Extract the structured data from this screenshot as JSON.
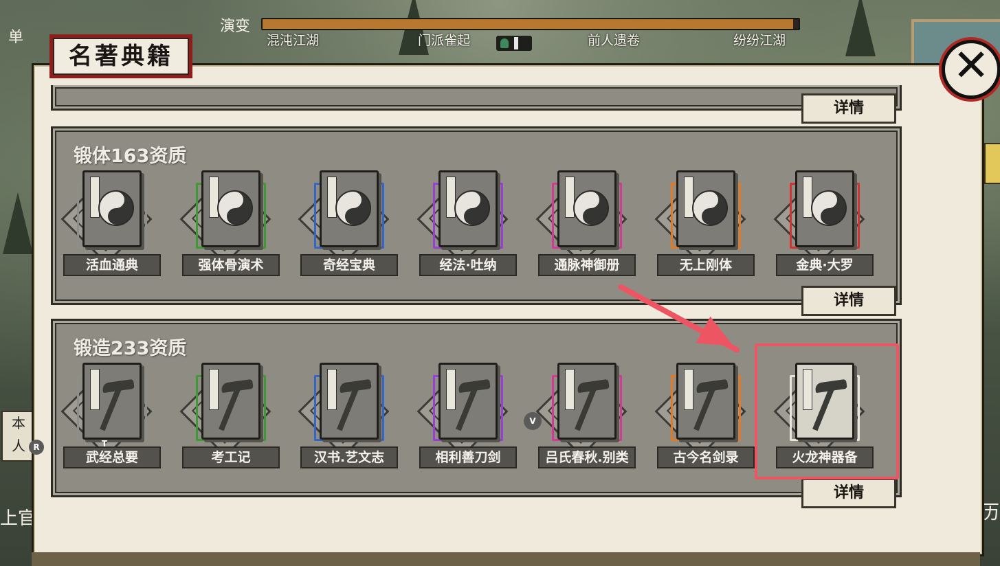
{
  "header": {
    "evolution_label": "演变",
    "progress": 0.99,
    "stages": [
      "混沌江湖",
      "门派雀起",
      "前人遗卷",
      "纷纷江湖"
    ]
  },
  "side": {
    "left_tag": "单",
    "ben_line1": "本",
    "ben_line2": "人",
    "shangguan": "上官",
    "right_li": "历"
  },
  "keys": {
    "r": "R",
    "t": "T",
    "v": "V"
  },
  "panel": {
    "title": "名著典籍",
    "close_icon": "close-icon",
    "detail_label": "详情",
    "sections": [
      {
        "title": "锻体163资质",
        "books": [
          {
            "name": "活血通典",
            "rarity_color": "#8f8f8a"
          },
          {
            "name": "强体骨演术",
            "rarity_color": "#3f9a35"
          },
          {
            "name": "奇经宝典",
            "rarity_color": "#3465c9"
          },
          {
            "name": "经法·吐纳",
            "rarity_color": "#9a3fd6"
          },
          {
            "name": "通脉神御册",
            "rarity_color": "#d23a94"
          },
          {
            "name": "无上刚体",
            "rarity_color": "#e07a26"
          },
          {
            "name": "金典·大罗",
            "rarity_color": "#d23232"
          }
        ]
      },
      {
        "title": "锻造233资质",
        "books": [
          {
            "name": "武经总要",
            "rarity_color": "#8f8f8a"
          },
          {
            "name": "考工记",
            "rarity_color": "#3f9a35"
          },
          {
            "name": "汉书.艺文志",
            "rarity_color": "#3465c9"
          },
          {
            "name": "相利善刀剑",
            "rarity_color": "#9a3fd6"
          },
          {
            "name": "吕氏春秋.别类",
            "rarity_color": "#d23a94"
          },
          {
            "name": "古今名剑录",
            "rarity_color": "#e07a26"
          },
          {
            "name": "火龙神器备",
            "rarity_color": "#e8e6dc"
          }
        ]
      }
    ]
  },
  "colors": {
    "highlight": "#ee5563",
    "title_frame": "#8f1d1a"
  }
}
